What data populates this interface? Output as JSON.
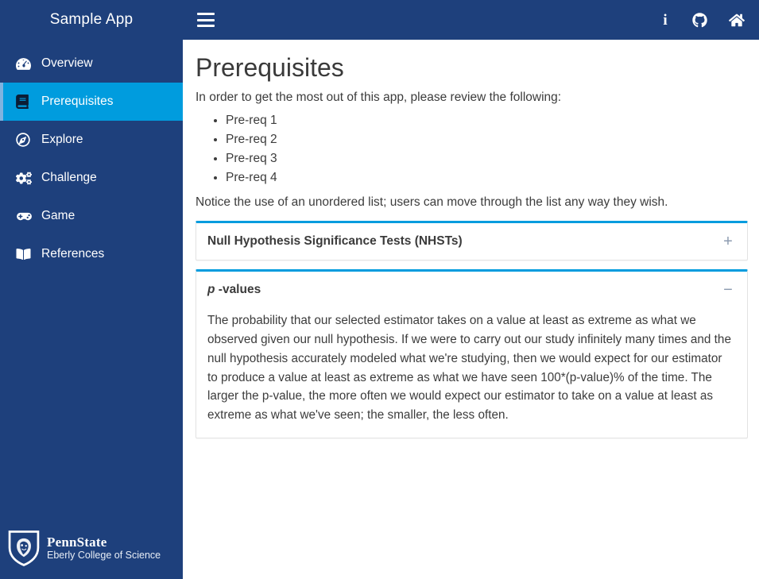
{
  "sidebar": {
    "title": "Sample App",
    "items": [
      {
        "label": "Overview",
        "icon": "tachometer-icon",
        "active": false
      },
      {
        "label": "Prerequisites",
        "icon": "book-list-icon",
        "active": true
      },
      {
        "label": "Explore",
        "icon": "compass-icon",
        "active": false
      },
      {
        "label": "Challenge",
        "icon": "cogs-icon",
        "active": false
      },
      {
        "label": "Game",
        "icon": "gamepad-icon",
        "active": false
      },
      {
        "label": "References",
        "icon": "open-book-icon",
        "active": false
      }
    ],
    "footer": {
      "logo_name": "PennState",
      "logo_subtitle": "Eberly College of Science"
    }
  },
  "topbar": {
    "menu_icon": "hamburger-icon",
    "icons": [
      {
        "name": "info-icon",
        "glyph": "i"
      },
      {
        "name": "github-icon",
        "glyph": ""
      },
      {
        "name": "home-icon",
        "glyph": ""
      }
    ]
  },
  "main": {
    "title": "Prerequisites",
    "intro": "In order to get the most out of this app, please review the following:",
    "prereq_list": [
      "Pre-req 1",
      "Pre-req 2",
      "Pre-req 3",
      "Pre-req 4"
    ],
    "note": "Notice the use of an unordered list; users can move through the list any way they wish.",
    "accordion": [
      {
        "title": "Null Hypothesis Significance Tests (NHSTs)",
        "title_italic_prefix": "",
        "expanded": false,
        "toggle": "+",
        "body": ""
      },
      {
        "title": "-values",
        "title_italic_prefix": "p",
        "expanded": true,
        "toggle": "−",
        "body": "The probability that our selected estimator takes on a value at least as extreme as what we observed given our null hypothesis. If we were to carry out our study infinitely many times and the null hypothesis accurately modeled what we're studying, then we would expect for our estimator to produce a value at least as extreme as what we have seen 100*(p-value)% of the time. The larger the p-value, the more often we would expect our estimator to take on a value at least as extreme as what we've seen; the smaller, the less often."
      }
    ]
  },
  "colors": {
    "brand_navy": "#1e407c",
    "accent_cyan": "#009cde",
    "active_border": "#7fb3e0",
    "text": "#3c3c3c"
  }
}
